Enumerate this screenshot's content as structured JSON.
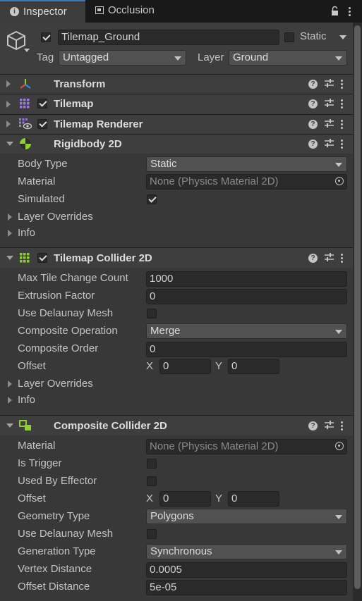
{
  "tabs": [
    {
      "label": "Inspector",
      "icon": "info-icon"
    },
    {
      "label": "Occlusion",
      "icon": "occlusion-icon"
    }
  ],
  "header": {
    "object_name": "Tilemap_Ground",
    "active": true,
    "static_label": "Static",
    "static": false,
    "tag_label": "Tag",
    "tag_value": "Untagged",
    "layer_label": "Layer",
    "layer_value": "Ground"
  },
  "components": {
    "transform": {
      "name": "Transform"
    },
    "tilemap": {
      "name": "Tilemap",
      "enabled": true
    },
    "tilemap_renderer": {
      "name": "Tilemap Renderer",
      "enabled": true
    },
    "rigidbody": {
      "name": "Rigidbody 2D",
      "body_type_label": "Body Type",
      "body_type": "Static",
      "material_label": "Material",
      "material": "None (Physics Material 2D)",
      "simulated_label": "Simulated",
      "simulated": true,
      "layer_overrides_label": "Layer Overrides",
      "info_label": "Info"
    },
    "tilemap_collider": {
      "name": "Tilemap Collider 2D",
      "enabled": true,
      "max_tile_label": "Max Tile Change Count",
      "max_tile": "1000",
      "extrusion_label": "Extrusion Factor",
      "extrusion": "0",
      "delaunay_label": "Use Delaunay Mesh",
      "delaunay": false,
      "composite_op_label": "Composite Operation",
      "composite_op": "Merge",
      "composite_order_label": "Composite Order",
      "composite_order": "0",
      "offset_label": "Offset",
      "offset_x": "0",
      "offset_y": "0",
      "layer_overrides_label": "Layer Overrides",
      "info_label": "Info"
    },
    "composite_collider": {
      "name": "Composite Collider 2D",
      "material_label": "Material",
      "material": "None (Physics Material 2D)",
      "is_trigger_label": "Is Trigger",
      "is_trigger": false,
      "used_by_effector_label": "Used By Effector",
      "used_by_effector": false,
      "offset_label": "Offset",
      "offset_x": "0",
      "offset_y": "0",
      "geometry_label": "Geometry Type",
      "geometry": "Polygons",
      "delaunay_label": "Use Delaunay Mesh",
      "delaunay": false,
      "generation_label": "Generation Type",
      "generation": "Synchronous",
      "vertex_label": "Vertex Distance",
      "vertex": "0.0005",
      "offset_distance_label": "Offset Distance",
      "offset_distance": "5e-05"
    }
  },
  "axis_labels": {
    "x": "X",
    "y": "Y"
  },
  "colors": {
    "accent": "#3a79bb",
    "background": "#383838",
    "header": "#3e3e3e"
  }
}
